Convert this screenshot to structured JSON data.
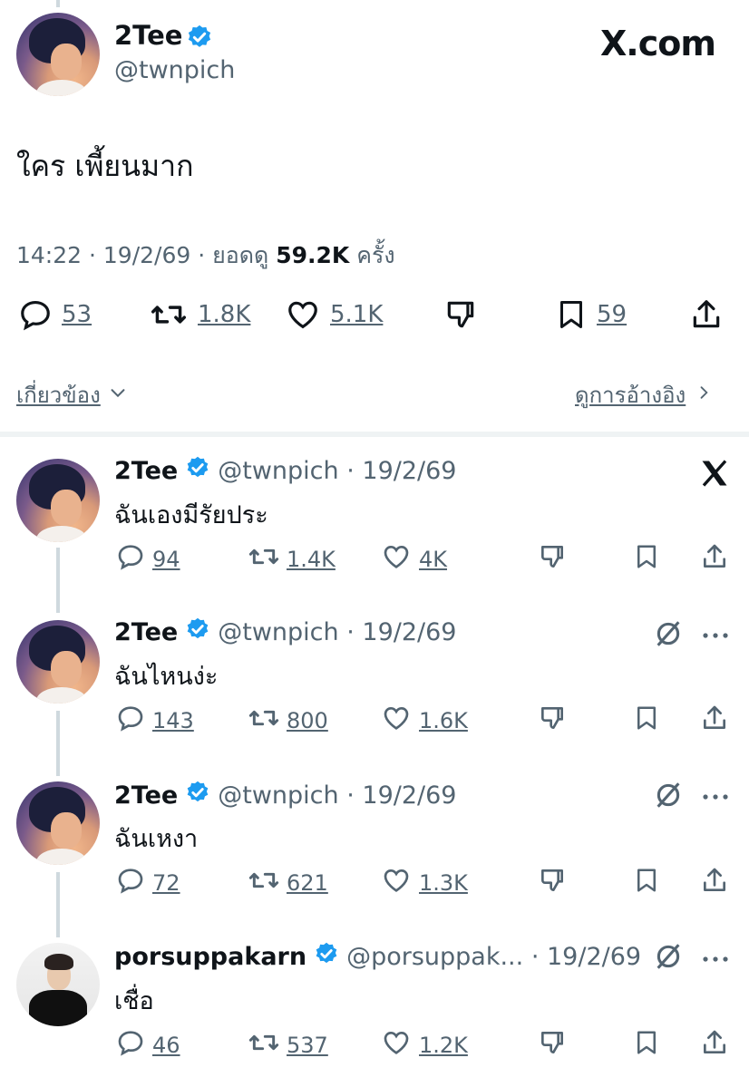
{
  "main_post": {
    "name": "2Tee",
    "handle": "@twnpich",
    "brand": "X.com",
    "text": "ใคร เพี้ยนมาก",
    "time": "14:22",
    "date": "19/2/69",
    "views_label": "ยอดดู",
    "views": "59.2K",
    "views_suffix": "ครั้ง",
    "replies": "53",
    "reposts": "1.8K",
    "likes": "5.1K",
    "bookmarks": "59"
  },
  "related": {
    "left_label": "เกี่ยวข้อง",
    "right_label": "ดูการอ้างอิง"
  },
  "replies": [
    {
      "name": "2Tee",
      "handle": "@twnpich",
      "date": "19/2/69",
      "text": "ฉันเองมีรัยประ",
      "replies": "94",
      "reposts": "1.4K",
      "likes": "4K"
    },
    {
      "name": "2Tee",
      "handle": "@twnpich",
      "date": "19/2/69",
      "text": "ฉันไหนง่ะ",
      "replies": "143",
      "reposts": "800",
      "likes": "1.6K"
    },
    {
      "name": "2Tee",
      "handle": "@twnpich",
      "date": "19/2/69",
      "text": "ฉันเหงา",
      "replies": "72",
      "reposts": "621",
      "likes": "1.3K"
    },
    {
      "name": "porsuppakarn",
      "handle": "@porsuppak...",
      "date": "19/2/69",
      "text": "เชื่อ",
      "replies": "46",
      "reposts": "537",
      "likes": "1.2K"
    }
  ],
  "colors": {
    "text": "#0f1419",
    "secondary": "#536471",
    "verified": "#1d9bf0",
    "divider": "#eff3f4",
    "thread_line": "#cfd9de"
  }
}
